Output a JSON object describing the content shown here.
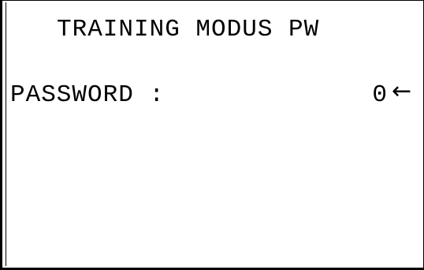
{
  "screen": {
    "title": "TRAINING MODUS PW",
    "password_label": "PASSWORD :",
    "password_value": "0",
    "cursor_glyph": "←",
    "cursor_icon": "left-arrow-icon"
  }
}
